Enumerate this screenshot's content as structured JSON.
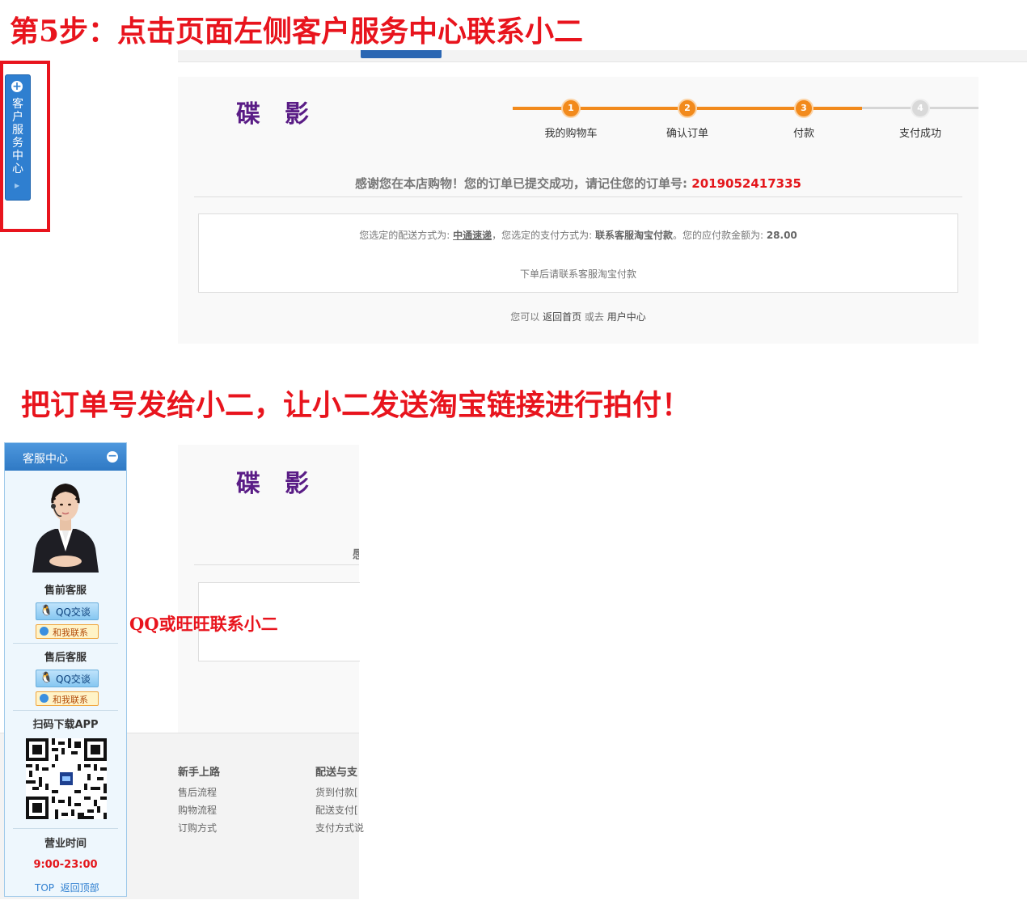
{
  "headings": {
    "step5": "第5步：点击页面左侧客户服务中心联系小二",
    "instruction": "把订单号发给小二，让小二发送淘宝链接进行拍付！",
    "qq_note": "QQ或旺旺联系小二"
  },
  "logo": "碟影",
  "steps": [
    {
      "num": "1",
      "label": "我的购物车"
    },
    {
      "num": "2",
      "label": "确认订单"
    },
    {
      "num": "3",
      "label": "付款"
    },
    {
      "num": "4",
      "label": "支付成功"
    }
  ],
  "order": {
    "thanks_text": "感谢您在本店购物！您的订单已提交成功，请记住您的订单号: ",
    "order_number": "2019052417335",
    "shipping_prefix": "您选定的配送方式为: ",
    "shipping_method": "中通速递",
    "payment_prefix": "，您选定的支付方式为: ",
    "payment_method": "联系客服淘宝付款",
    "amount_prefix": "。您的应付款金额为: ",
    "amount": "28.00",
    "note": "下单后请联系客服淘宝付款",
    "back_prefix": "您可以 ",
    "home_link": "返回首页",
    "or_text": " 或去 ",
    "user_center_link": "用户中心"
  },
  "sidebar_tab": {
    "label": "客户服务中心",
    "expand_icon": "plus-circle-icon",
    "arrow_icon": "triangle-right-icon"
  },
  "service_center": {
    "title": "客服中心",
    "collapse_icon": "minus-circle-icon",
    "presale": "售前客服",
    "aftersale": "售后客服",
    "qq_button": "QQ交谈",
    "ww_button": "和我联系",
    "app_title": "扫码下载APP",
    "hours_title": "营业时间",
    "hours": "9:00-23:00",
    "top_label": "TOP",
    "back_top": "返回顶部"
  },
  "footer": {
    "col1_title": "新手上路",
    "col1_links": [
      "售后流程",
      "购物流程",
      "订购方式"
    ],
    "col2_title": "配送与支",
    "col2_links": [
      "货到付款[",
      "配送支付[",
      "支付方式说"
    ]
  },
  "colors": {
    "annotation_red": "#e8141d",
    "step_orange": "#f28a1c",
    "order_number_red": "#e4161b",
    "logo_purple": "#5a1d86",
    "panel_blue": "#2f7fd0"
  }
}
